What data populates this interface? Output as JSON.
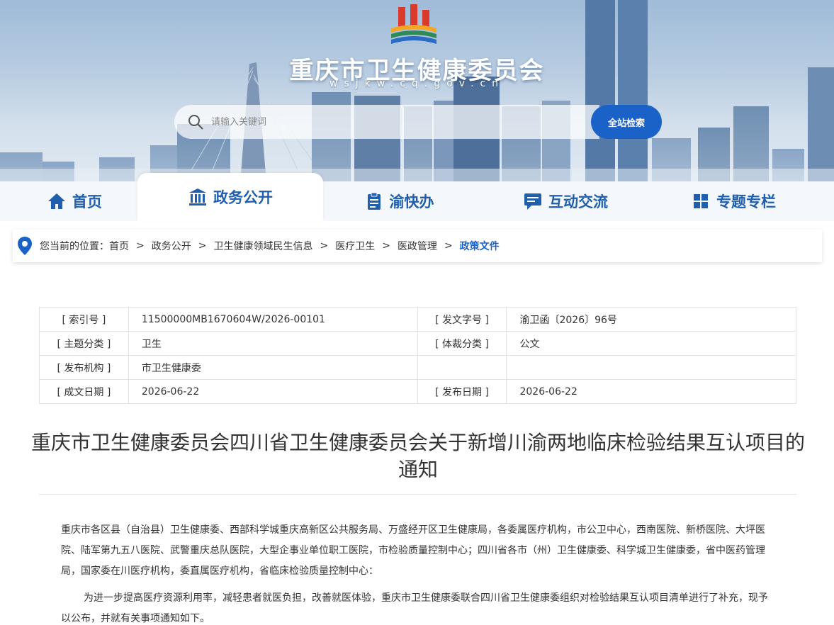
{
  "header": {
    "site_title": "重庆市卫生健康委员会",
    "site_domain": "wsjkw.cq.gov.cn",
    "search": {
      "placeholder": "请输入关键词",
      "button_label": "全站检索"
    }
  },
  "nav": {
    "items": [
      {
        "label": "首页",
        "icon": "home-icon"
      },
      {
        "label": "政务公开",
        "icon": "government-building-icon",
        "active": true
      },
      {
        "label": "渝快办",
        "icon": "clipboard-icon"
      },
      {
        "label": "互动交流",
        "icon": "chat-icon"
      },
      {
        "label": "专题专栏",
        "icon": "grid-icon"
      }
    ]
  },
  "breadcrumb": {
    "prefix": "您当前的位置：",
    "items": [
      "首页",
      "政务公开",
      "卫生健康领域民生信息",
      "医疗卫生",
      "医政管理",
      "政策文件"
    ],
    "separator": ">"
  },
  "meta": {
    "rows": [
      {
        "k1": "[ 索引号 ]",
        "v1": "11500000MB1670604W/2026-00101",
        "k2": "[ 发文字号 ]",
        "v2": "渝卫函〔2026〕96号"
      },
      {
        "k1": "[ 主题分类 ]",
        "v1": "卫生",
        "k2": "[ 体裁分类 ]",
        "v2": "公文"
      },
      {
        "k1": "[ 发布机构 ]",
        "v1": "市卫生健康委",
        "k2": "",
        "v2": ""
      },
      {
        "k1": "[ 成文日期 ]",
        "v1": "2026-06-22",
        "k2": "[ 发布日期 ]",
        "v2": "2026-06-22"
      }
    ]
  },
  "article": {
    "title": "重庆市卫生健康委员会四川省卫生健康委员会关于新增川渝两地临床检验结果互认项目的通知",
    "recipients": "重庆市各区县（自治县）卫生健康委、西部科学城重庆高新区公共服务局、万盛经开区卫生健康局，各委属医疗机构，市公卫中心，西南医院、新桥医院、大坪医院、陆军第九五八医院、武警重庆总队医院，大型企事业单位职工医院，市检验质量控制中心；四川省各市（州）卫生健康委、科学城卫生健康委，省中医药管理局，国家委在川医疗机构，委直属医疗机构，省临床检验质量控制中心：",
    "intro": "为进一步提高医疗资源利用率，减轻患者就医负担，改善就医体验，重庆市卫生健康委联合四川省卫生健康委组织对检验结果互认项目清单进行了补充，现予以公布，并就有关事项通知如下。"
  },
  "colors": {
    "brand_blue": "#1a62c8",
    "nav_text": "#1f5fae"
  }
}
